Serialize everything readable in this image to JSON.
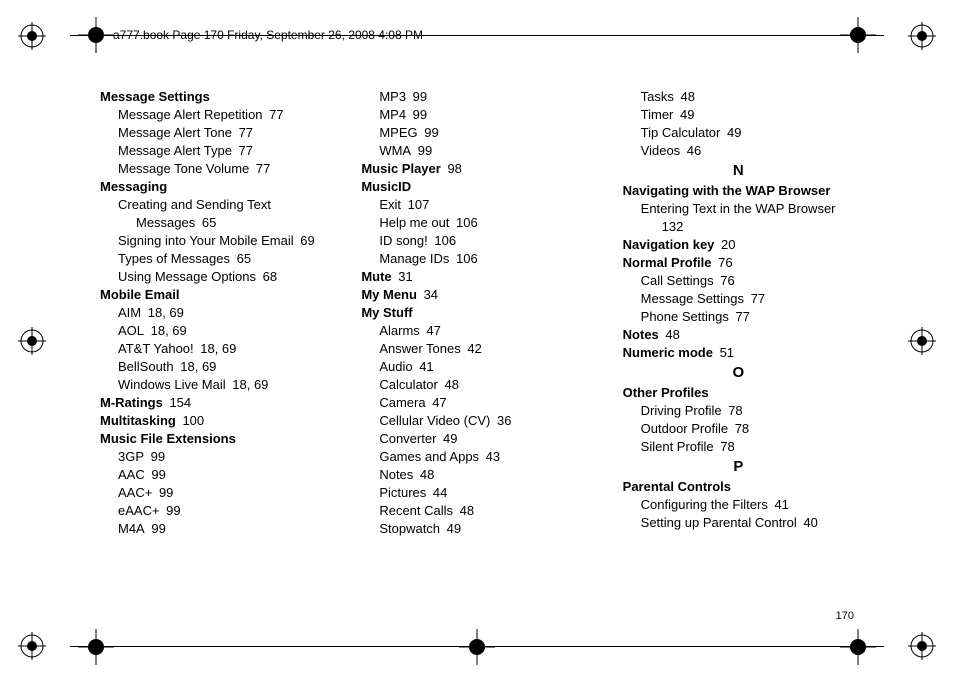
{
  "header": "a777.book  Page 170  Friday, September 26, 2008  4:08 PM",
  "page_number": "170",
  "columns": [
    [
      {
        "t": "heading",
        "text": "Message Settings"
      },
      {
        "t": "sub",
        "text": "Message Alert Repetition",
        "pg": "77"
      },
      {
        "t": "sub",
        "text": "Message Alert Tone",
        "pg": "77"
      },
      {
        "t": "sub",
        "text": "Message Alert Type",
        "pg": "77"
      },
      {
        "t": "sub",
        "text": "Message Tone Volume",
        "pg": "77"
      },
      {
        "t": "heading",
        "text": "Messaging"
      },
      {
        "t": "sub",
        "text": "Creating and Sending Text"
      },
      {
        "t": "cont",
        "text": "Messages",
        "pg": "65"
      },
      {
        "t": "sub",
        "text": "Signing into Your Mobile Email",
        "pg": "69"
      },
      {
        "t": "sub",
        "text": "Types of Messages",
        "pg": "65"
      },
      {
        "t": "sub",
        "text": "Using Message Options",
        "pg": "68"
      },
      {
        "t": "heading",
        "text": "Mobile Email"
      },
      {
        "t": "sub",
        "text": "AIM",
        "pg": "18, 69"
      },
      {
        "t": "sub",
        "text": "AOL",
        "pg": "18, 69"
      },
      {
        "t": "sub",
        "text": "AT&T Yahoo!",
        "pg": "18, 69"
      },
      {
        "t": "sub",
        "text": "BellSouth",
        "pg": "18, 69"
      },
      {
        "t": "sub",
        "text": "Windows Live Mail",
        "pg": "18, 69"
      },
      {
        "t": "heading",
        "text": "M-Ratings",
        "pg": "154"
      },
      {
        "t": "heading",
        "text": "Multitasking",
        "pg": "100"
      },
      {
        "t": "heading",
        "text": "Music File Extensions"
      },
      {
        "t": "sub",
        "text": "3GP",
        "pg": "99"
      },
      {
        "t": "sub",
        "text": "AAC",
        "pg": "99"
      },
      {
        "t": "sub",
        "text": "AAC+",
        "pg": "99"
      },
      {
        "t": "sub",
        "text": "eAAC+",
        "pg": "99"
      },
      {
        "t": "sub",
        "text": "M4A",
        "pg": "99"
      }
    ],
    [
      {
        "t": "sub",
        "text": "MP3",
        "pg": "99"
      },
      {
        "t": "sub",
        "text": "MP4",
        "pg": "99"
      },
      {
        "t": "sub",
        "text": "MPEG",
        "pg": "99"
      },
      {
        "t": "sub",
        "text": "WMA",
        "pg": "99"
      },
      {
        "t": "heading",
        "text": "Music Player",
        "pg": "98"
      },
      {
        "t": "heading",
        "text": "MusicID"
      },
      {
        "t": "sub",
        "text": "Exit",
        "pg": "107"
      },
      {
        "t": "sub",
        "text": "Help me out",
        "pg": "106"
      },
      {
        "t": "sub",
        "text": "ID song!",
        "pg": "106"
      },
      {
        "t": "sub",
        "text": "Manage IDs",
        "pg": "106"
      },
      {
        "t": "heading",
        "text": "Mute",
        "pg": "31"
      },
      {
        "t": "heading",
        "text": "My Menu",
        "pg": "34"
      },
      {
        "t": "heading",
        "text": "My Stuff"
      },
      {
        "t": "sub",
        "text": "Alarms",
        "pg": "47"
      },
      {
        "t": "sub",
        "text": "Answer Tones",
        "pg": "42"
      },
      {
        "t": "sub",
        "text": "Audio",
        "pg": "41"
      },
      {
        "t": "sub",
        "text": "Calculator",
        "pg": "48"
      },
      {
        "t": "sub",
        "text": "Camera",
        "pg": "47"
      },
      {
        "t": "sub",
        "text": "Cellular Video (CV)",
        "pg": "36"
      },
      {
        "t": "sub",
        "text": "Converter",
        "pg": "49"
      },
      {
        "t": "sub",
        "text": "Games and Apps",
        "pg": "43"
      },
      {
        "t": "sub",
        "text": "Notes",
        "pg": "48"
      },
      {
        "t": "sub",
        "text": "Pictures",
        "pg": "44"
      },
      {
        "t": "sub",
        "text": "Recent Calls",
        "pg": "48"
      },
      {
        "t": "sub",
        "text": "Stopwatch",
        "pg": "49"
      }
    ],
    [
      {
        "t": "sub",
        "text": "Tasks",
        "pg": "48"
      },
      {
        "t": "sub",
        "text": "Timer",
        "pg": "49"
      },
      {
        "t": "sub",
        "text": "Tip Calculator",
        "pg": "49"
      },
      {
        "t": "sub",
        "text": "Videos",
        "pg": "46"
      },
      {
        "t": "letter",
        "text": "N"
      },
      {
        "t": "heading",
        "text": "Navigating with the WAP Browser"
      },
      {
        "t": "sub",
        "text": "Entering Text in the WAP Browser"
      },
      {
        "t": "cont",
        "text": "",
        "pg": "132"
      },
      {
        "t": "heading",
        "text": "Navigation key",
        "pg": "20"
      },
      {
        "t": "heading",
        "text": "Normal Profile",
        "pg": "76"
      },
      {
        "t": "sub",
        "text": "Call Settings",
        "pg": "76"
      },
      {
        "t": "sub",
        "text": "Message Settings",
        "pg": "77"
      },
      {
        "t": "sub",
        "text": "Phone Settings",
        "pg": "77"
      },
      {
        "t": "heading",
        "text": "Notes",
        "pg": "48"
      },
      {
        "t": "heading",
        "text": "Numeric mode",
        "pg": "51"
      },
      {
        "t": "letter",
        "text": "O"
      },
      {
        "t": "heading",
        "text": "Other Profiles"
      },
      {
        "t": "sub",
        "text": "Driving Profile",
        "pg": "78"
      },
      {
        "t": "sub",
        "text": "Outdoor Profile",
        "pg": "78"
      },
      {
        "t": "sub",
        "text": "Silent Profile",
        "pg": "78"
      },
      {
        "t": "letter",
        "text": "P"
      },
      {
        "t": "heading",
        "text": "Parental Controls"
      },
      {
        "t": "sub",
        "text": "Configuring the Filters",
        "pg": "41"
      },
      {
        "t": "sub",
        "text": "Setting up Parental Control",
        "pg": "40"
      }
    ]
  ]
}
